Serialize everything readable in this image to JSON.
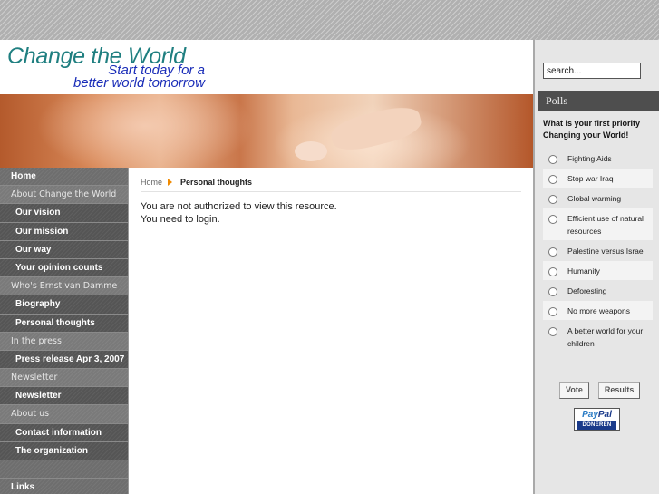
{
  "header": {
    "title": "Change the World",
    "subtitle_line1": "Start today for a",
    "subtitle_line2": "better world tomorrow"
  },
  "sidebar": {
    "items": [
      {
        "label": "Home",
        "kind": "top"
      },
      {
        "label": "About Change the World",
        "kind": "section"
      },
      {
        "label": "Our vision",
        "kind": "sub"
      },
      {
        "label": "Our mission",
        "kind": "sub"
      },
      {
        "label": "Our way",
        "kind": "sub"
      },
      {
        "label": "Your opinion counts",
        "kind": "sub"
      },
      {
        "label": "Who's Ernst van Damme",
        "kind": "section"
      },
      {
        "label": "Biography",
        "kind": "sub"
      },
      {
        "label": "Personal thoughts",
        "kind": "sub"
      },
      {
        "label": "In the press",
        "kind": "section"
      },
      {
        "label": "Press release Apr 3, 2007",
        "kind": "sub"
      },
      {
        "label": "Newsletter",
        "kind": "section"
      },
      {
        "label": "Newsletter",
        "kind": "sub"
      },
      {
        "label": "About us",
        "kind": "section"
      },
      {
        "label": "Contact information",
        "kind": "sub"
      },
      {
        "label": "The organization",
        "kind": "sub"
      },
      {
        "label": "",
        "kind": "gap"
      },
      {
        "label": "Links",
        "kind": "top"
      }
    ]
  },
  "breadcrumb": {
    "home": "Home",
    "current": "Personal thoughts"
  },
  "main": {
    "message_line1": "You are not authorized to view this resource.",
    "message_line2": "You need to login."
  },
  "search": {
    "value": "search..."
  },
  "polls": {
    "header": "Polls",
    "question": "What is your first priority Changing your World!",
    "options": [
      "Fighting Aids",
      "Stop war Iraq",
      "Global warming",
      "Efficient use of natural resources",
      "Palestine versus Israel",
      "Humanity",
      "Deforesting",
      "No more weapons",
      "A better world for your children"
    ],
    "vote_label": "Vote",
    "results_label": "Results"
  },
  "paypal": {
    "brand_pay": "Pay",
    "brand_pal": "Pal",
    "caption": "DONEREN"
  },
  "colors": {
    "title": "#1f7f80",
    "subtitle": "#1a2db8",
    "breadcrumb_arrow": "#f08a00",
    "sidebar": "#6b6b6b",
    "polls_header": "#4e4e4e"
  }
}
